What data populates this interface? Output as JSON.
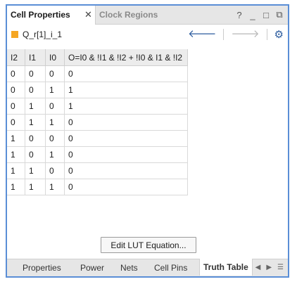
{
  "tabs": {
    "active": "Cell Properties",
    "inactive": "Clock Regions",
    "close": "✕"
  },
  "window_controls": [
    "?",
    "_",
    "□",
    "⧉"
  ],
  "object": {
    "name": "Q_r[1]_i_1",
    "color": "#f5a623"
  },
  "nav": {
    "back": "🡐",
    "forward": "🡒",
    "settings": "⚙"
  },
  "truth_table": {
    "headers": [
      "I2",
      "I1",
      "I0",
      "O=I0 & !I1 & !I2 + !I0 & I1 & !I2"
    ],
    "rows": [
      [
        "0",
        "0",
        "0",
        "0"
      ],
      [
        "0",
        "0",
        "1",
        "1"
      ],
      [
        "0",
        "1",
        "0",
        "1"
      ],
      [
        "0",
        "1",
        "1",
        "0"
      ],
      [
        "1",
        "0",
        "0",
        "0"
      ],
      [
        "1",
        "0",
        "1",
        "0"
      ],
      [
        "1",
        "1",
        "0",
        "0"
      ],
      [
        "1",
        "1",
        "1",
        "0"
      ]
    ]
  },
  "edit_button": "Edit LUT Equation...",
  "bottom_tabs": [
    "Properties",
    "Power",
    "Nets",
    "Cell Pins",
    "Truth Table"
  ],
  "bottom_controls": [
    "◀",
    "▶",
    "☰"
  ]
}
